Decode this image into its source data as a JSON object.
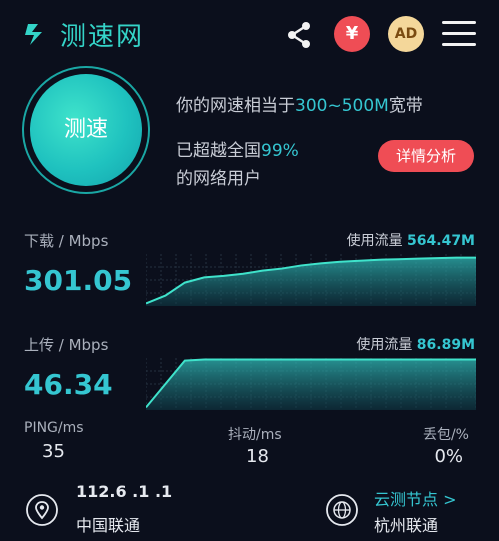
{
  "header": {
    "app_name": "测速网",
    "yen_label": "¥",
    "ad_label": "AD"
  },
  "speed_button_label": "测速",
  "summary": {
    "line1_prefix": "你的网速相当于",
    "line1_range": "300~500M",
    "line1_suffix": "宽带",
    "line2_prefix": "已超越全国",
    "line2_percent": "99%",
    "line3": "的网络用户",
    "detail_button": "详情分析"
  },
  "download": {
    "label": "下载 / Mbps",
    "value": "301.05",
    "usage_label": "使用流量",
    "usage_value": "564.47M"
  },
  "upload": {
    "label": "上传 / Mbps",
    "value": "46.34",
    "usage_label": "使用流量",
    "usage_value": "86.89M"
  },
  "stats": {
    "ping_label": "PING/ms",
    "ping_value": "35",
    "jitter_label": "抖动/ms",
    "jitter_value": "18",
    "loss_label": "丢包/%",
    "loss_value": "0%"
  },
  "footer": {
    "ip": "112.6 .1  .1  ",
    "isp": "中国联通",
    "cloud_link": "云测节点 >",
    "node": "杭州联通"
  },
  "colors": {
    "accent": "#35c6d1",
    "red": "#ef4d55",
    "background": "#0b0f1c"
  },
  "chart_data": [
    {
      "type": "area",
      "name": "download",
      "values": [
        0.05,
        0.2,
        0.45,
        0.55,
        0.58,
        0.62,
        0.68,
        0.72,
        0.78,
        0.82,
        0.85,
        0.87,
        0.89,
        0.9,
        0.91,
        0.92,
        0.93,
        0.93
      ]
    },
    {
      "type": "area",
      "name": "upload",
      "values": [
        0.05,
        0.5,
        0.95,
        0.97,
        0.97,
        0.97,
        0.97,
        0.97,
        0.97,
        0.97,
        0.97,
        0.97,
        0.97,
        0.97,
        0.97,
        0.97,
        0.97,
        0.97
      ]
    }
  ]
}
